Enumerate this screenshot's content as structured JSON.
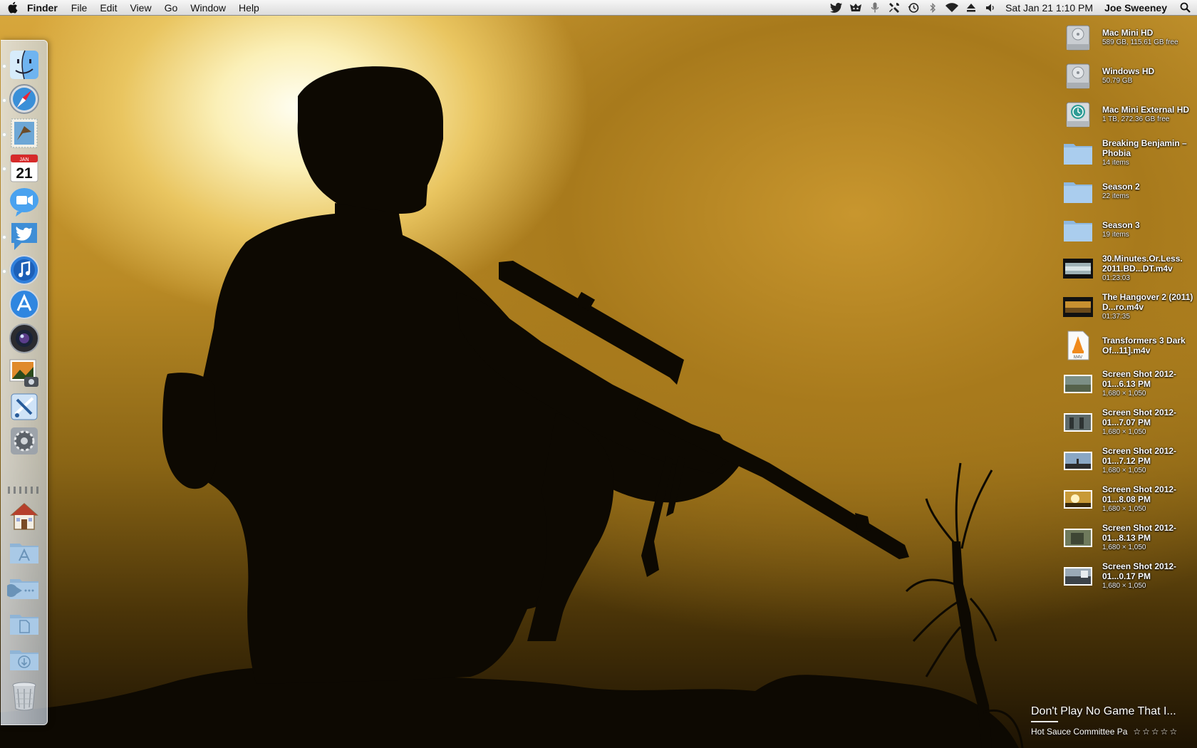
{
  "menubar": {
    "app_name": "Finder",
    "menus": [
      "File",
      "Edit",
      "View",
      "Go",
      "Window",
      "Help"
    ],
    "status_icons": [
      "twitter-icon",
      "growl-icon",
      "microphone-icon",
      "wrench-icon",
      "time-machine-icon",
      "bluetooth-icon",
      "wifi-icon",
      "eject-icon",
      "volume-icon"
    ],
    "clock": "Sat Jan 21  1:10 PM",
    "user": "Joe Sweeney",
    "search_icon": "spotlight-icon"
  },
  "dock": {
    "items": [
      {
        "name": "finder",
        "running": true
      },
      {
        "name": "safari",
        "running": true
      },
      {
        "name": "mail",
        "running": true
      },
      {
        "name": "ical",
        "running": true,
        "date": "21",
        "month": "JAN"
      },
      {
        "name": "facetime",
        "running": false
      },
      {
        "name": "twitter",
        "running": true
      },
      {
        "name": "itunes",
        "running": true
      },
      {
        "name": "app-store",
        "running": false
      },
      {
        "name": "photo-booth",
        "running": false
      },
      {
        "name": "iphoto",
        "running": false
      },
      {
        "name": "xcode",
        "running": false
      },
      {
        "name": "system-preferences",
        "running": false
      },
      {
        "name": "home-folder",
        "running": false
      },
      {
        "name": "applications-folder",
        "running": false
      },
      {
        "name": "games-folder",
        "running": false
      },
      {
        "name": "documents-folder",
        "running": false
      },
      {
        "name": "downloads-folder",
        "running": false
      },
      {
        "name": "trash",
        "running": false
      }
    ]
  },
  "desktop": {
    "items": [
      {
        "type": "drive",
        "name": "Mac Mini HD",
        "info": "589 GB, 115.61 GB free"
      },
      {
        "type": "drive",
        "name": "Windows HD",
        "info": "50.79 GB"
      },
      {
        "type": "timemachine",
        "name": "Mac Mini External HD",
        "info": "1 TB, 272.36 GB free"
      },
      {
        "type": "folder",
        "name": "Breaking Benjamin – Phobia",
        "info": "14 items"
      },
      {
        "type": "folder",
        "name": "Season 2",
        "info": "22 items"
      },
      {
        "type": "folder",
        "name": "Season 3",
        "info": "19 items"
      },
      {
        "type": "video",
        "name": "30.Minutes.Or.Less. 2011.BD...DT.m4v",
        "info": "01:23:03"
      },
      {
        "type": "video2",
        "name": "The Hangover 2 (2011) D...ro.m4v",
        "info": "01:37:35"
      },
      {
        "type": "vlc",
        "name": "Transformers 3 Dark Of...11].m4v",
        "info": ""
      },
      {
        "type": "shot",
        "name": "Screen Shot 2012-01...6.13 PM",
        "info": "1,680 × 1,050"
      },
      {
        "type": "shot",
        "name": "Screen Shot 2012-01...7.07 PM",
        "info": "1,680 × 1,050"
      },
      {
        "type": "shot",
        "name": "Screen Shot 2012-01...7.12 PM",
        "info": "1,680 × 1,050"
      },
      {
        "type": "shot",
        "name": "Screen Shot 2012-01...8.08 PM",
        "info": "1,680 × 1,050"
      },
      {
        "type": "shot",
        "name": "Screen Shot 2012-01...8.13 PM",
        "info": "1,680 × 1,050"
      },
      {
        "type": "shot",
        "name": "Screen Shot 2012-01...0.17 PM",
        "info": "1,680 × 1,050"
      }
    ]
  },
  "now_playing": {
    "title": "Don't Play No Game That I...",
    "artist": "Hot Sauce Committee Pa",
    "rating": "☆☆☆☆☆"
  },
  "colors": {
    "sky_bright": "#fffef2",
    "sky_gold": "#d9a83d",
    "silhouette": "#0d0902",
    "menubar": "#e8e8e8"
  }
}
